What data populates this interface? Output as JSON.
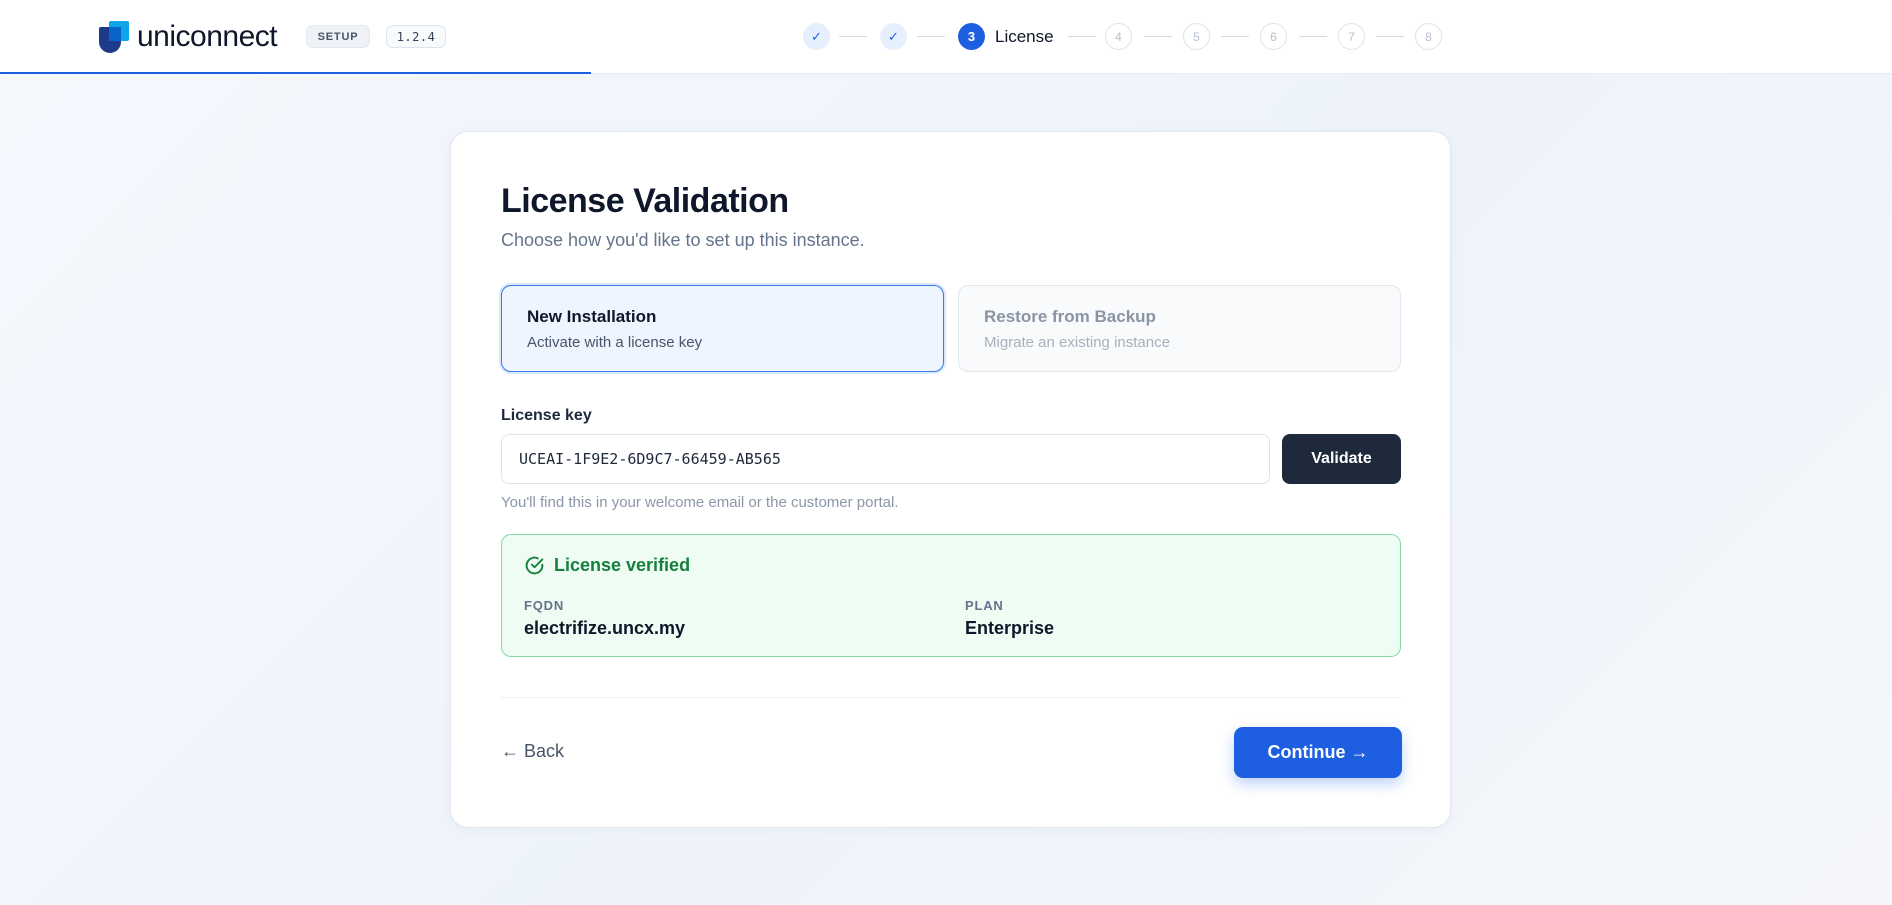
{
  "header": {
    "brand": "uniconnect",
    "setup_badge": "SETUP",
    "version": "1.2.4",
    "progress_fraction": 0.3125
  },
  "stepper": {
    "steps": [
      {
        "number": "1",
        "status": "done",
        "symbol": "✓"
      },
      {
        "number": "2",
        "status": "done",
        "symbol": "✓"
      },
      {
        "number": "3",
        "status": "active",
        "label": "License"
      },
      {
        "number": "4",
        "status": "todo"
      },
      {
        "number": "5",
        "status": "todo"
      },
      {
        "number": "6",
        "status": "todo"
      },
      {
        "number": "7",
        "status": "todo"
      },
      {
        "number": "8",
        "status": "todo"
      }
    ]
  },
  "card": {
    "title": "License Validation",
    "subtitle": "Choose how you'd like to set up this instance.",
    "options": [
      {
        "title": "New Installation",
        "description": "Activate with a license key",
        "selected": true
      },
      {
        "title": "Restore from Backup",
        "description": "Migrate an existing instance",
        "selected": false
      }
    ],
    "license_label": "License key",
    "license_value": "UCEAI-1F9E2-6D9C7-66459-AB565",
    "validate_label": "Validate",
    "hint": "You'll find this in your welcome email or the customer portal.",
    "verified": {
      "heading": "License verified",
      "fqdn_label": "FQDN",
      "fqdn_value": "electrifize.uncx.my",
      "plan_label": "PLAN",
      "plan_value": "Enterprise"
    },
    "back_label": "← Back",
    "continue_label": "Continue →"
  },
  "colors": {
    "accent": "#1d5fe0",
    "success": "#15803d",
    "dark_button": "#1e293b"
  }
}
